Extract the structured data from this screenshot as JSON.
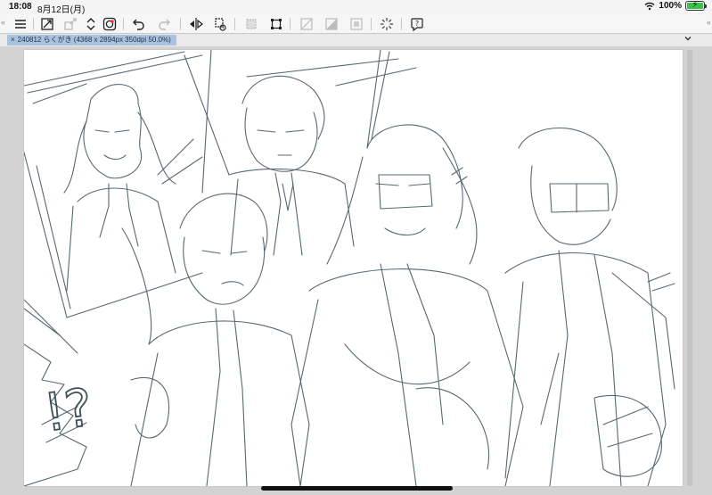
{
  "status": {
    "time": "18:08",
    "date": "8月12日(月)",
    "battery": "100%",
    "battery_level": 1.0
  },
  "toolbar": {
    "icons": [
      "menu-icon",
      "fit-screen-icon",
      "transform-icon",
      "scroll-arrows-icon",
      "clip-studio-icon",
      "undo-icon",
      "redo-icon",
      "flip-horizontal-icon",
      "rotate-view-icon",
      "select-layer-icon",
      "crop-icon",
      "clear-icon",
      "fill-icon",
      "border-icon",
      "loading-icon",
      "help-icon"
    ]
  },
  "tab": {
    "close": "×",
    "label": "240812 らくがき (4368 x 2894px 350dpi 50.0%)"
  },
  "colors": {
    "tab_bg": "#a9c2dd",
    "sketch": "#3a4f58",
    "battery": "#3bc24a"
  },
  "canvas": {
    "sketch_text": "!?"
  }
}
